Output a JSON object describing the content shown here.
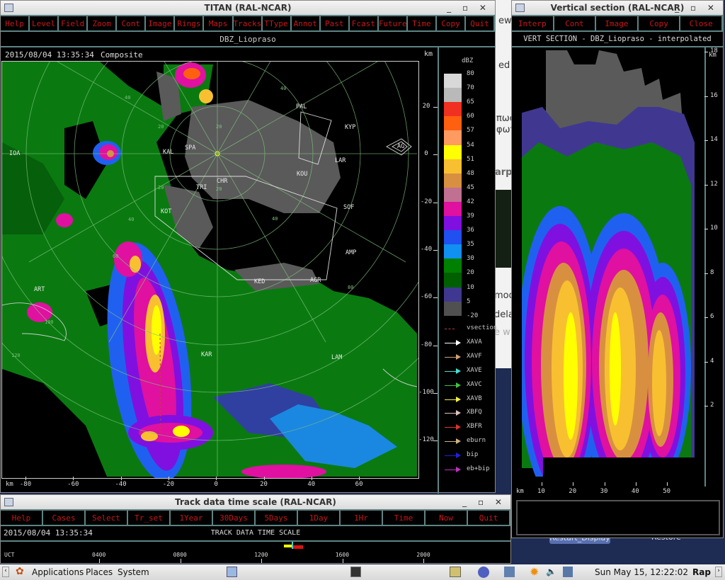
{
  "background": {
    "fragments": [
      "ew",
      "ed",
      "πωσ",
      "φωτ",
      "arp",
      "mod",
      "dela",
      "e w",
      "Restart_Display",
      "Restore"
    ]
  },
  "titan": {
    "title": "TITAN (RAL-NCAR)",
    "menu": [
      "Help",
      "Level",
      "Field",
      "Zoom",
      "Cont",
      "Image",
      "Rings",
      "Maps",
      "Tracks",
      "TType",
      "Annot",
      "Past",
      "Fcast",
      "Future",
      "Time",
      "Copy",
      "Quit"
    ],
    "field": "DBZ_Liopraso",
    "datetime": "2015/08/04 13:35:34",
    "mode": "Composite",
    "km_label": "km",
    "y_ticks": [
      "20",
      "0",
      "-20",
      "-40",
      "-60",
      "-80",
      "-100",
      "-120"
    ],
    "x_ticks": [
      "-80",
      "-60",
      "-40",
      "-20",
      "0",
      "20",
      "40",
      "60"
    ],
    "ring_labels": [
      "20",
      "20",
      "20",
      "20",
      "40",
      "40",
      "40",
      "40",
      "60",
      "80",
      "100",
      "120"
    ],
    "stations": [
      "IOA",
      "KAL",
      "SPA",
      "CHR",
      "TRI",
      "KOT",
      "PAL",
      "KYP",
      "LAR",
      "KOU",
      "SOF",
      "AMP",
      "KED",
      "AGR",
      "AG",
      "ART",
      "KAR",
      "LAM"
    ],
    "legend": {
      "unit": "dBZ",
      "labels": [
        "80",
        "70",
        "65",
        "60",
        "57",
        "54",
        "51",
        "48",
        "45",
        "42",
        "39",
        "36",
        "35",
        "30",
        "20",
        "10",
        "5",
        "-20"
      ],
      "colors": [
        "#d8d8d8",
        "#b9b9b9",
        "#f03020",
        "#ff6010",
        "#ff9a60",
        "#ffff00",
        "#f8c030",
        "#d89040",
        "#c07090",
        "#e010a0",
        "#8010e0",
        "#2050f0",
        "#1090f0",
        "#008000",
        "#006000",
        "#403890",
        "#505050"
      ],
      "tracks": [
        {
          "label": "vsection",
          "color": "#c04040"
        },
        {
          "label": "XAVA",
          "color": "#ffffff"
        },
        {
          "label": "XAVF",
          "color": "#d0a070"
        },
        {
          "label": "XAVE",
          "color": "#40e0d0"
        },
        {
          "label": "XAVC",
          "color": "#40c040"
        },
        {
          "label": "XAVB",
          "color": "#f0f040"
        },
        {
          "label": "XBFQ",
          "color": "#e0c0c0"
        },
        {
          "label": "XBFR",
          "color": "#e03030"
        },
        {
          "label": "eburn",
          "color": "#d0b080"
        },
        {
          "label": "bip",
          "color": "#2020e0"
        },
        {
          "label": "eb+bip",
          "color": "#c030c0"
        }
      ]
    }
  },
  "vsection": {
    "title": "Vertical section (RAL-NCAR)",
    "menu": [
      "Interp",
      "Cont",
      "Image",
      "Copy",
      "Close"
    ],
    "header": "VERT SECTION - DBZ_Liopraso - interpolated",
    "km_label": "km",
    "y_ticks": [
      "18",
      "16",
      "14",
      "12",
      "10",
      "8",
      "6",
      "4",
      "2"
    ],
    "x_ticks": [
      "10",
      "20",
      "30",
      "40",
      "50"
    ]
  },
  "track": {
    "title": "Track data time scale (RAL-NCAR)",
    "menu": [
      "Help",
      "Cases",
      "Select",
      "Tr_set",
      "1Year",
      "30Days",
      "5Days",
      "1Day",
      "1Hr",
      "Time",
      "Now",
      "Quit"
    ],
    "datetime": "2015/08/04 13:35:34",
    "header": "TRACK DATA TIME SCALE",
    "axis_label": "UCT",
    "ticks": [
      "0400",
      "0800",
      "1200",
      "1600",
      "2000"
    ]
  },
  "taskbar": {
    "applications": "Applications",
    "places": "Places",
    "system": "System",
    "clock": "Sun May 15, 12:22:02",
    "user": "Rap"
  }
}
